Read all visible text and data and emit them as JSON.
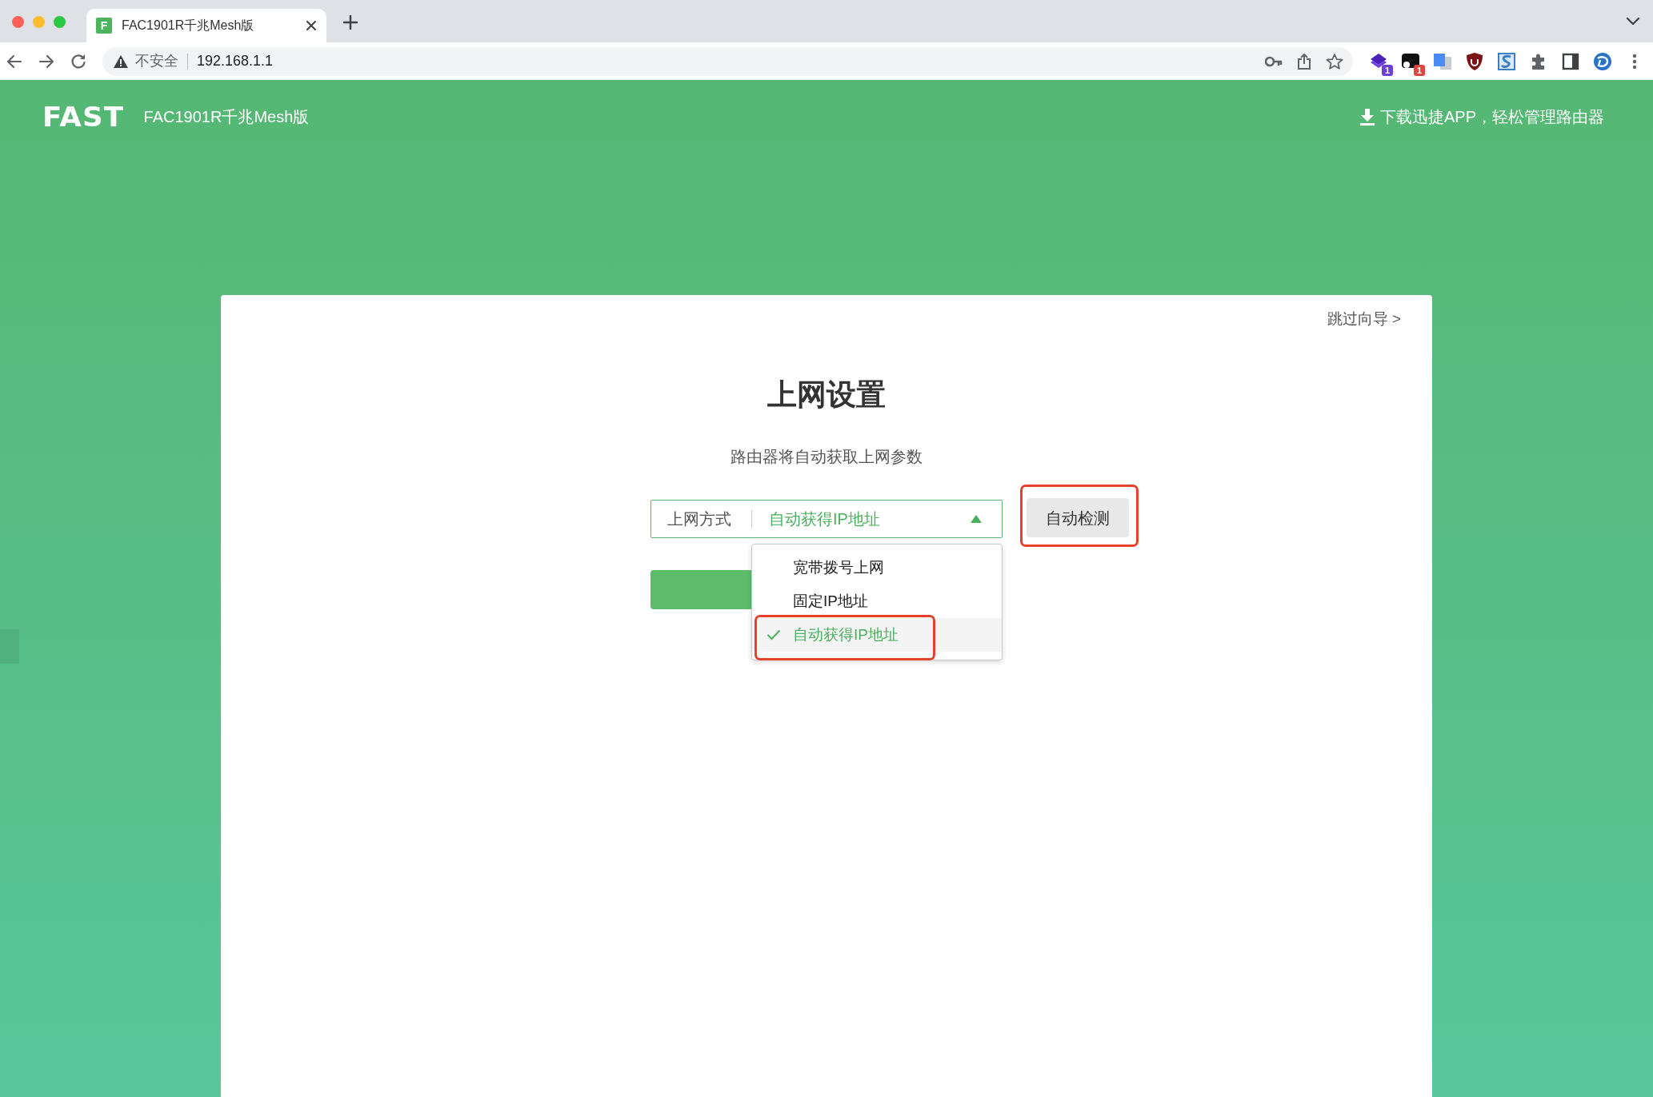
{
  "browser": {
    "tabs": [
      {
        "favicon": "F",
        "title": "FAC1901R千兆Mesh版",
        "selected": true
      }
    ],
    "address_bar": {
      "security_label": "不安全",
      "url": "192.168.1.1"
    },
    "toolbar_icons": [
      {
        "kind": "stack",
        "badge": "1"
      },
      {
        "kind": "dot-tile",
        "badge": "1"
      },
      {
        "kind": "tiles"
      },
      {
        "kind": "shield"
      },
      {
        "kind": "wave-tile"
      },
      {
        "kind": "puzzle"
      },
      {
        "kind": "side-panel"
      },
      {
        "kind": "profile"
      },
      {
        "kind": "menu"
      }
    ]
  },
  "header": {
    "logo": "FAST",
    "model": "FAC1901R千兆Mesh版",
    "app_link": "下载迅捷APP，轻松管理路由器"
  },
  "wizard": {
    "skip": "跳过向导 >",
    "title": "上网设置",
    "subtitle": "路由器将自动获取上网参数",
    "connection": {
      "label": "上网方式",
      "value": "自动获得IP地址",
      "expanded": true,
      "options": [
        {
          "label": "宽带拨号上网",
          "selected": false,
          "highlighted": false
        },
        {
          "label": "固定IP地址",
          "selected": false,
          "highlighted": false
        },
        {
          "label": "自动获得IP地址",
          "selected": true,
          "highlighted": true
        }
      ]
    },
    "detect_button": {
      "label": "自动检测",
      "highlighted": true
    }
  }
}
